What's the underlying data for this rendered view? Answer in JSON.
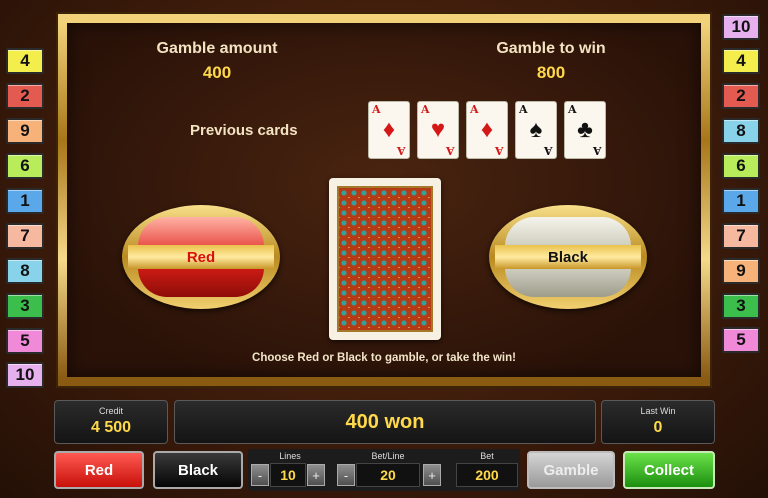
{
  "left_lines": [
    {
      "label": "4",
      "color": "#f3ee4b"
    },
    {
      "label": "2",
      "color": "#e35a50"
    },
    {
      "label": "9",
      "color": "#f7b27a"
    },
    {
      "label": "6",
      "color": "#b8ec5a"
    },
    {
      "label": "1",
      "color": "#5aa8ea"
    },
    {
      "label": "7",
      "color": "#f6b9a0"
    },
    {
      "label": "8",
      "color": "#88d2ea"
    },
    {
      "label": "3",
      "color": "#3cbe4c"
    },
    {
      "label": "5",
      "color": "#f08ad8"
    },
    {
      "label": "10",
      "color": "#e6b0ee"
    }
  ],
  "right_lines": [
    {
      "label": "10",
      "color": "#e6b0ee"
    },
    {
      "label": "4",
      "color": "#f3ee4b"
    },
    {
      "label": "2",
      "color": "#e35a50"
    },
    {
      "label": "8",
      "color": "#88d2ea"
    },
    {
      "label": "6",
      "color": "#b8ec5a"
    },
    {
      "label": "1",
      "color": "#5aa8ea"
    },
    {
      "label": "7",
      "color": "#f6b9a0"
    },
    {
      "label": "9",
      "color": "#f7b27a"
    },
    {
      "label": "3",
      "color": "#3cbe4c"
    },
    {
      "label": "5",
      "color": "#f08ad8"
    }
  ],
  "gamble": {
    "amount_label": "Gamble amount",
    "amount": "400",
    "to_win_label": "Gamble to win",
    "to_win": "800",
    "previous_label": "Previous cards",
    "previous_cards": [
      {
        "rank": "A",
        "suit": "♦",
        "color": "red"
      },
      {
        "rank": "A",
        "suit": "♥",
        "color": "red"
      },
      {
        "rank": "A",
        "suit": "♦",
        "color": "red"
      },
      {
        "rank": "A",
        "suit": "♠",
        "color": "black"
      },
      {
        "rank": "A",
        "suit": "♣",
        "color": "black"
      }
    ],
    "red_label": "Red",
    "black_label": "Black",
    "instruction": "Choose Red or Black to gamble, or take the win!"
  },
  "status": {
    "credit_label": "Credit",
    "credit_value": "4 500",
    "won_text": "400 won",
    "last_win_label": "Last Win",
    "last_win_value": "0"
  },
  "controls": {
    "red_button": "Red",
    "black_button": "Black",
    "lines_label": "Lines",
    "lines_value": "10",
    "bet_line_label": "Bet/Line",
    "bet_line_value": "20",
    "bet_label": "Bet",
    "bet_value": "200",
    "minus": "-",
    "plus": "+",
    "gamble_button": "Gamble",
    "collect_button": "Collect"
  }
}
